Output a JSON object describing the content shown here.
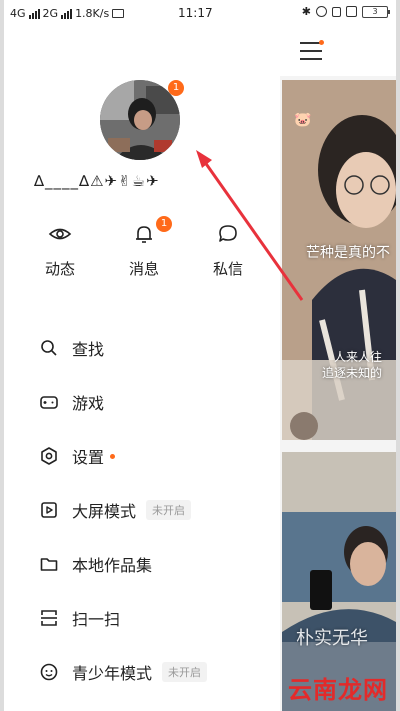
{
  "status_bar": {
    "network1": "4G",
    "network2": "2G",
    "speed": "1.8K/s",
    "time": "11:17",
    "battery": "3"
  },
  "profile": {
    "avatar_badge": "1",
    "username": "∆____∆⚠✈✌☕✈"
  },
  "quick_actions": [
    {
      "label": "动态",
      "icon": "eye-icon"
    },
    {
      "label": "消息",
      "icon": "bell-icon",
      "badge": "1"
    },
    {
      "label": "私信",
      "icon": "chat-bubble-icon"
    }
  ],
  "menu": {
    "search": "查找",
    "games": "游戏",
    "settings": "设置",
    "bigscreen": "大屏模式",
    "bigscreen_tag": "未开启",
    "local_works": "本地作品集",
    "scan": "扫一扫",
    "teen": "青少年模式",
    "teen_tag": "未开启"
  },
  "feed": {
    "caption1": "芒种是真的不",
    "caption2": "人来人往",
    "caption3": "追逐未知的",
    "caption4": "朴实无华"
  },
  "watermark": "云南龙网",
  "colors": {
    "accent": "#ff6a1a",
    "arrow": "#e8323c"
  }
}
